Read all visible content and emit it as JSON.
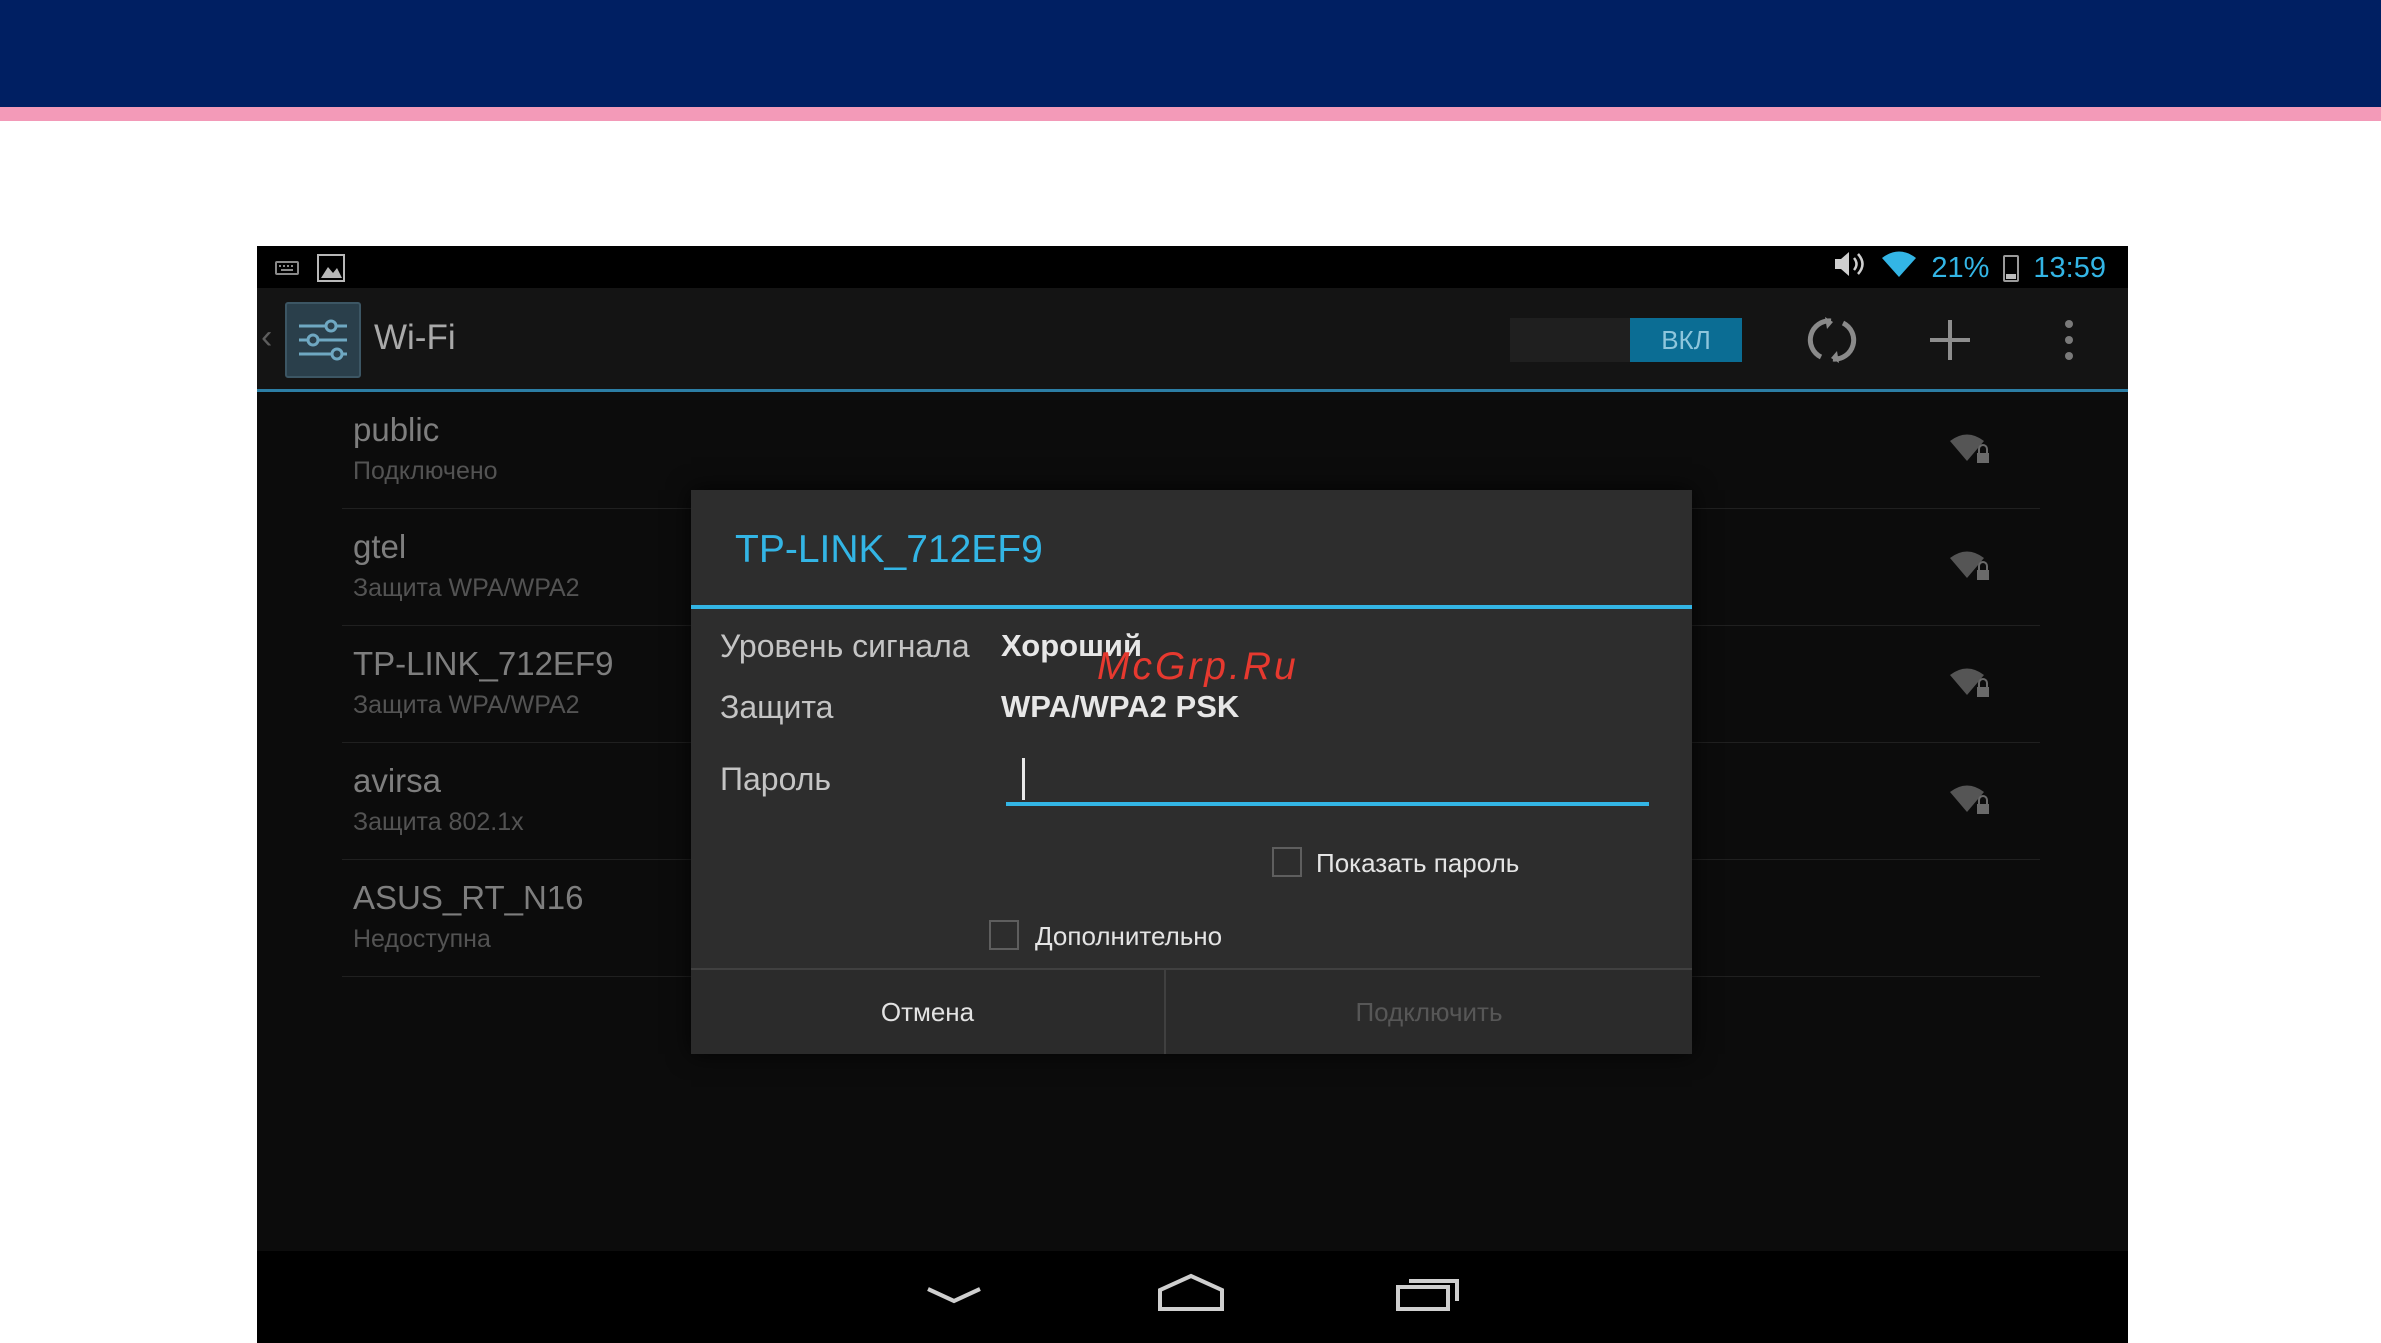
{
  "statusbar": {
    "battery": "21%",
    "time": "13:59",
    "left_icons": [
      "keyboard-icon",
      "image-notification-icon"
    ],
    "right_icons": [
      "volume-icon",
      "wifi-signal-icon",
      "battery-icon"
    ]
  },
  "actionbar": {
    "title": "Wi-Fi",
    "toggle_label": "ВКЛ",
    "icons": [
      "back-caret-icon",
      "settings-app-icon",
      "wps-icon",
      "add-icon",
      "overflow-menu-icon"
    ]
  },
  "networks": [
    {
      "name": "public",
      "status": "Подключено",
      "icon": "wifi-locked-icon"
    },
    {
      "name": "gtel",
      "status": "Защита WPA/WPA2",
      "icon": "wifi-locked-icon"
    },
    {
      "name": "TP-LINK_712EF9",
      "status": "Защита WPA/WPA2",
      "icon": "wifi-locked-icon"
    },
    {
      "name": "avirsa",
      "status": "Защита 802.1x",
      "icon": "wifi-locked-icon"
    },
    {
      "name": "ASUS_RT_N16",
      "status": "Недоступна"
    }
  ],
  "dialog": {
    "title": "TP-LINK_712EF9",
    "signal_label": "Уровень сигнала",
    "signal_value": "Хороший",
    "security_label": "Защита",
    "security_value": "WPA/WPA2 PSK",
    "password_label": "Пароль",
    "password_value": "",
    "show_password_label": "Показать пароль",
    "advanced_label": "Дополнительно",
    "cancel_label": "Отмена",
    "connect_label": "Подключить"
  },
  "watermark": "McGrp.Ru",
  "navbar": {
    "icons": [
      "back-icon",
      "home-icon",
      "recent-apps-icon"
    ]
  },
  "colors": {
    "slide_header": "#001f62",
    "slide_stripe": "#f39ab8",
    "accent": "#33b5e5",
    "watermark": "#e6392f"
  }
}
